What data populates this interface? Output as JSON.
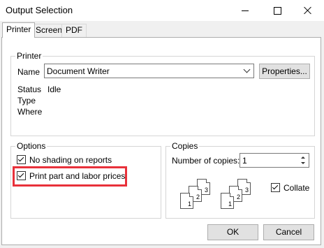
{
  "window": {
    "title": "Output Selection"
  },
  "tabs": [
    {
      "label": "Printer",
      "active": true
    },
    {
      "label": "Screen",
      "active": false
    },
    {
      "label": "PDF",
      "active": false
    }
  ],
  "printer": {
    "group_label": "Printer",
    "name_label": "Name",
    "name_value": "Document Writer",
    "properties_label": "Properties...",
    "status_label": "Status",
    "status_value": "Idle",
    "type_label": "Type",
    "type_value": "",
    "where_label": "Where",
    "where_value": ""
  },
  "options": {
    "group_label": "Options",
    "items": [
      {
        "label": "No shading on reports",
        "checked": true
      },
      {
        "label": "Print part and labor prices",
        "checked": true,
        "highlighted": true
      }
    ]
  },
  "copies": {
    "group_label": "Copies",
    "number_label": "Number of copies:",
    "number_value": "1",
    "collate_label": "Collate",
    "collate_checked": true,
    "collate_icon": "collate-pages-icon",
    "page_numbers": [
      "1",
      "2",
      "3"
    ]
  },
  "buttons": {
    "ok_label": "OK",
    "cancel_label": "Cancel"
  },
  "colors": {
    "highlight": "#e8313a"
  }
}
